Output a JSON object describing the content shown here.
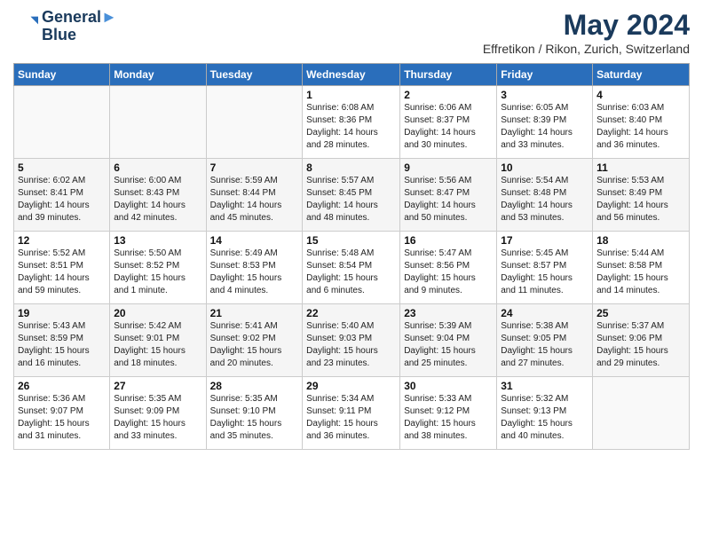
{
  "header": {
    "logo_line1": "General",
    "logo_line2": "Blue",
    "main_title": "May 2024",
    "subtitle": "Effretikon / Rikon, Zurich, Switzerland"
  },
  "weekdays": [
    "Sunday",
    "Monday",
    "Tuesday",
    "Wednesday",
    "Thursday",
    "Friday",
    "Saturday"
  ],
  "weeks": [
    [
      {
        "num": "",
        "info": ""
      },
      {
        "num": "",
        "info": ""
      },
      {
        "num": "",
        "info": ""
      },
      {
        "num": "1",
        "info": "Sunrise: 6:08 AM\nSunset: 8:36 PM\nDaylight: 14 hours\nand 28 minutes."
      },
      {
        "num": "2",
        "info": "Sunrise: 6:06 AM\nSunset: 8:37 PM\nDaylight: 14 hours\nand 30 minutes."
      },
      {
        "num": "3",
        "info": "Sunrise: 6:05 AM\nSunset: 8:39 PM\nDaylight: 14 hours\nand 33 minutes."
      },
      {
        "num": "4",
        "info": "Sunrise: 6:03 AM\nSunset: 8:40 PM\nDaylight: 14 hours\nand 36 minutes."
      }
    ],
    [
      {
        "num": "5",
        "info": "Sunrise: 6:02 AM\nSunset: 8:41 PM\nDaylight: 14 hours\nand 39 minutes."
      },
      {
        "num": "6",
        "info": "Sunrise: 6:00 AM\nSunset: 8:43 PM\nDaylight: 14 hours\nand 42 minutes."
      },
      {
        "num": "7",
        "info": "Sunrise: 5:59 AM\nSunset: 8:44 PM\nDaylight: 14 hours\nand 45 minutes."
      },
      {
        "num": "8",
        "info": "Sunrise: 5:57 AM\nSunset: 8:45 PM\nDaylight: 14 hours\nand 48 minutes."
      },
      {
        "num": "9",
        "info": "Sunrise: 5:56 AM\nSunset: 8:47 PM\nDaylight: 14 hours\nand 50 minutes."
      },
      {
        "num": "10",
        "info": "Sunrise: 5:54 AM\nSunset: 8:48 PM\nDaylight: 14 hours\nand 53 minutes."
      },
      {
        "num": "11",
        "info": "Sunrise: 5:53 AM\nSunset: 8:49 PM\nDaylight: 14 hours\nand 56 minutes."
      }
    ],
    [
      {
        "num": "12",
        "info": "Sunrise: 5:52 AM\nSunset: 8:51 PM\nDaylight: 14 hours\nand 59 minutes."
      },
      {
        "num": "13",
        "info": "Sunrise: 5:50 AM\nSunset: 8:52 PM\nDaylight: 15 hours\nand 1 minute."
      },
      {
        "num": "14",
        "info": "Sunrise: 5:49 AM\nSunset: 8:53 PM\nDaylight: 15 hours\nand 4 minutes."
      },
      {
        "num": "15",
        "info": "Sunrise: 5:48 AM\nSunset: 8:54 PM\nDaylight: 15 hours\nand 6 minutes."
      },
      {
        "num": "16",
        "info": "Sunrise: 5:47 AM\nSunset: 8:56 PM\nDaylight: 15 hours\nand 9 minutes."
      },
      {
        "num": "17",
        "info": "Sunrise: 5:45 AM\nSunset: 8:57 PM\nDaylight: 15 hours\nand 11 minutes."
      },
      {
        "num": "18",
        "info": "Sunrise: 5:44 AM\nSunset: 8:58 PM\nDaylight: 15 hours\nand 14 minutes."
      }
    ],
    [
      {
        "num": "19",
        "info": "Sunrise: 5:43 AM\nSunset: 8:59 PM\nDaylight: 15 hours\nand 16 minutes."
      },
      {
        "num": "20",
        "info": "Sunrise: 5:42 AM\nSunset: 9:01 PM\nDaylight: 15 hours\nand 18 minutes."
      },
      {
        "num": "21",
        "info": "Sunrise: 5:41 AM\nSunset: 9:02 PM\nDaylight: 15 hours\nand 20 minutes."
      },
      {
        "num": "22",
        "info": "Sunrise: 5:40 AM\nSunset: 9:03 PM\nDaylight: 15 hours\nand 23 minutes."
      },
      {
        "num": "23",
        "info": "Sunrise: 5:39 AM\nSunset: 9:04 PM\nDaylight: 15 hours\nand 25 minutes."
      },
      {
        "num": "24",
        "info": "Sunrise: 5:38 AM\nSunset: 9:05 PM\nDaylight: 15 hours\nand 27 minutes."
      },
      {
        "num": "25",
        "info": "Sunrise: 5:37 AM\nSunset: 9:06 PM\nDaylight: 15 hours\nand 29 minutes."
      }
    ],
    [
      {
        "num": "26",
        "info": "Sunrise: 5:36 AM\nSunset: 9:07 PM\nDaylight: 15 hours\nand 31 minutes."
      },
      {
        "num": "27",
        "info": "Sunrise: 5:35 AM\nSunset: 9:09 PM\nDaylight: 15 hours\nand 33 minutes."
      },
      {
        "num": "28",
        "info": "Sunrise: 5:35 AM\nSunset: 9:10 PM\nDaylight: 15 hours\nand 35 minutes."
      },
      {
        "num": "29",
        "info": "Sunrise: 5:34 AM\nSunset: 9:11 PM\nDaylight: 15 hours\nand 36 minutes."
      },
      {
        "num": "30",
        "info": "Sunrise: 5:33 AM\nSunset: 9:12 PM\nDaylight: 15 hours\nand 38 minutes."
      },
      {
        "num": "31",
        "info": "Sunrise: 5:32 AM\nSunset: 9:13 PM\nDaylight: 15 hours\nand 40 minutes."
      },
      {
        "num": "",
        "info": ""
      }
    ]
  ]
}
